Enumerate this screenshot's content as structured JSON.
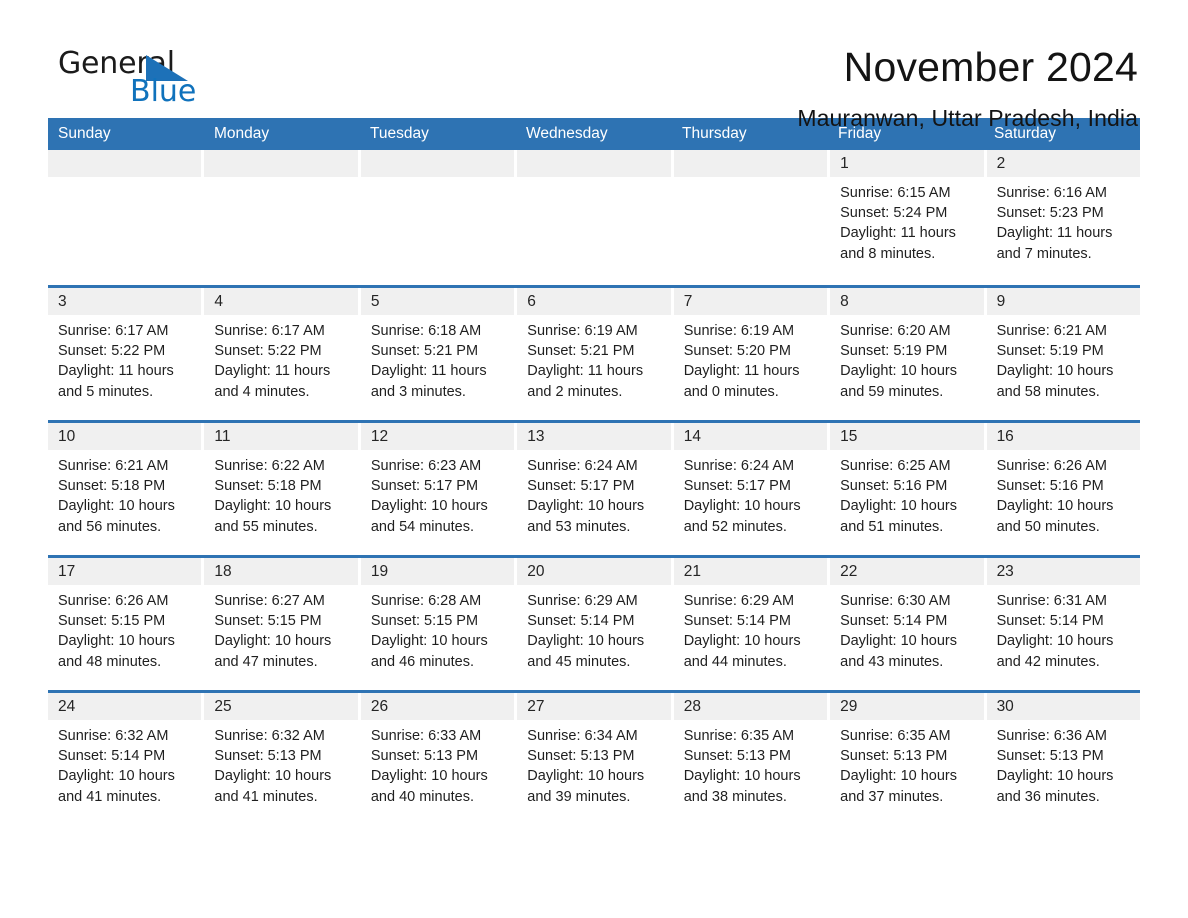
{
  "brand": {
    "name_part1": "General",
    "name_part2": "Blue",
    "accent_color": "#1072bc",
    "triangle_color": "#1d71b8"
  },
  "header": {
    "title": "November 2024",
    "location": "Mauranwan, Uttar Pradesh, India"
  },
  "theme": {
    "header_blue": "#2e73b3",
    "daynum_strip": "#f0f0f0",
    "text": "#1f1f1f"
  },
  "calendar": {
    "day_headers": [
      "Sunday",
      "Monday",
      "Tuesday",
      "Wednesday",
      "Thursday",
      "Friday",
      "Saturday"
    ],
    "weeks": [
      [
        {
          "day": "",
          "empty": true
        },
        {
          "day": "",
          "empty": true
        },
        {
          "day": "",
          "empty": true
        },
        {
          "day": "",
          "empty": true
        },
        {
          "day": "",
          "empty": true
        },
        {
          "day": "1",
          "sunrise": "Sunrise: 6:15 AM",
          "sunset": "Sunset: 5:24 PM",
          "daylight": "Daylight: 11 hours and 8 minutes."
        },
        {
          "day": "2",
          "sunrise": "Sunrise: 6:16 AM",
          "sunset": "Sunset: 5:23 PM",
          "daylight": "Daylight: 11 hours and 7 minutes."
        }
      ],
      [
        {
          "day": "3",
          "sunrise": "Sunrise: 6:17 AM",
          "sunset": "Sunset: 5:22 PM",
          "daylight": "Daylight: 11 hours and 5 minutes."
        },
        {
          "day": "4",
          "sunrise": "Sunrise: 6:17 AM",
          "sunset": "Sunset: 5:22 PM",
          "daylight": "Daylight: 11 hours and 4 minutes."
        },
        {
          "day": "5",
          "sunrise": "Sunrise: 6:18 AM",
          "sunset": "Sunset: 5:21 PM",
          "daylight": "Daylight: 11 hours and 3 minutes."
        },
        {
          "day": "6",
          "sunrise": "Sunrise: 6:19 AM",
          "sunset": "Sunset: 5:21 PM",
          "daylight": "Daylight: 11 hours and 2 minutes."
        },
        {
          "day": "7",
          "sunrise": "Sunrise: 6:19 AM",
          "sunset": "Sunset: 5:20 PM",
          "daylight": "Daylight: 11 hours and 0 minutes."
        },
        {
          "day": "8",
          "sunrise": "Sunrise: 6:20 AM",
          "sunset": "Sunset: 5:19 PM",
          "daylight": "Daylight: 10 hours and 59 minutes."
        },
        {
          "day": "9",
          "sunrise": "Sunrise: 6:21 AM",
          "sunset": "Sunset: 5:19 PM",
          "daylight": "Daylight: 10 hours and 58 minutes."
        }
      ],
      [
        {
          "day": "10",
          "sunrise": "Sunrise: 6:21 AM",
          "sunset": "Sunset: 5:18 PM",
          "daylight": "Daylight: 10 hours and 56 minutes."
        },
        {
          "day": "11",
          "sunrise": "Sunrise: 6:22 AM",
          "sunset": "Sunset: 5:18 PM",
          "daylight": "Daylight: 10 hours and 55 minutes."
        },
        {
          "day": "12",
          "sunrise": "Sunrise: 6:23 AM",
          "sunset": "Sunset: 5:17 PM",
          "daylight": "Daylight: 10 hours and 54 minutes."
        },
        {
          "day": "13",
          "sunrise": "Sunrise: 6:24 AM",
          "sunset": "Sunset: 5:17 PM",
          "daylight": "Daylight: 10 hours and 53 minutes."
        },
        {
          "day": "14",
          "sunrise": "Sunrise: 6:24 AM",
          "sunset": "Sunset: 5:17 PM",
          "daylight": "Daylight: 10 hours and 52 minutes."
        },
        {
          "day": "15",
          "sunrise": "Sunrise: 6:25 AM",
          "sunset": "Sunset: 5:16 PM",
          "daylight": "Daylight: 10 hours and 51 minutes."
        },
        {
          "day": "16",
          "sunrise": "Sunrise: 6:26 AM",
          "sunset": "Sunset: 5:16 PM",
          "daylight": "Daylight: 10 hours and 50 minutes."
        }
      ],
      [
        {
          "day": "17",
          "sunrise": "Sunrise: 6:26 AM",
          "sunset": "Sunset: 5:15 PM",
          "daylight": "Daylight: 10 hours and 48 minutes."
        },
        {
          "day": "18",
          "sunrise": "Sunrise: 6:27 AM",
          "sunset": "Sunset: 5:15 PM",
          "daylight": "Daylight: 10 hours and 47 minutes."
        },
        {
          "day": "19",
          "sunrise": "Sunrise: 6:28 AM",
          "sunset": "Sunset: 5:15 PM",
          "daylight": "Daylight: 10 hours and 46 minutes."
        },
        {
          "day": "20",
          "sunrise": "Sunrise: 6:29 AM",
          "sunset": "Sunset: 5:14 PM",
          "daylight": "Daylight: 10 hours and 45 minutes."
        },
        {
          "day": "21",
          "sunrise": "Sunrise: 6:29 AM",
          "sunset": "Sunset: 5:14 PM",
          "daylight": "Daylight: 10 hours and 44 minutes."
        },
        {
          "day": "22",
          "sunrise": "Sunrise: 6:30 AM",
          "sunset": "Sunset: 5:14 PM",
          "daylight": "Daylight: 10 hours and 43 minutes."
        },
        {
          "day": "23",
          "sunrise": "Sunrise: 6:31 AM",
          "sunset": "Sunset: 5:14 PM",
          "daylight": "Daylight: 10 hours and 42 minutes."
        }
      ],
      [
        {
          "day": "24",
          "sunrise": "Sunrise: 6:32 AM",
          "sunset": "Sunset: 5:14 PM",
          "daylight": "Daylight: 10 hours and 41 minutes."
        },
        {
          "day": "25",
          "sunrise": "Sunrise: 6:32 AM",
          "sunset": "Sunset: 5:13 PM",
          "daylight": "Daylight: 10 hours and 41 minutes."
        },
        {
          "day": "26",
          "sunrise": "Sunrise: 6:33 AM",
          "sunset": "Sunset: 5:13 PM",
          "daylight": "Daylight: 10 hours and 40 minutes."
        },
        {
          "day": "27",
          "sunrise": "Sunrise: 6:34 AM",
          "sunset": "Sunset: 5:13 PM",
          "daylight": "Daylight: 10 hours and 39 minutes."
        },
        {
          "day": "28",
          "sunrise": "Sunrise: 6:35 AM",
          "sunset": "Sunset: 5:13 PM",
          "daylight": "Daylight: 10 hours and 38 minutes."
        },
        {
          "day": "29",
          "sunrise": "Sunrise: 6:35 AM",
          "sunset": "Sunset: 5:13 PM",
          "daylight": "Daylight: 10 hours and 37 minutes."
        },
        {
          "day": "30",
          "sunrise": "Sunrise: 6:36 AM",
          "sunset": "Sunset: 5:13 PM",
          "daylight": "Daylight: 10 hours and 36 minutes."
        }
      ]
    ]
  }
}
